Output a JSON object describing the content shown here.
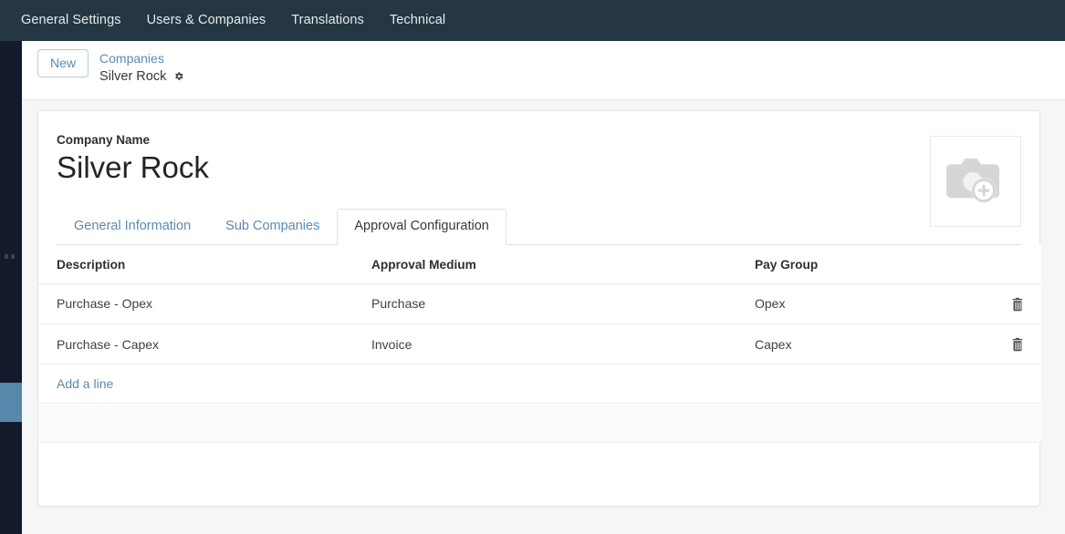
{
  "navbar": {
    "items": [
      {
        "label": "General Settings",
        "name": "nav-general-settings"
      },
      {
        "label": "Users & Companies",
        "name": "nav-users-companies"
      },
      {
        "label": "Translations",
        "name": "nav-translations"
      },
      {
        "label": "Technical",
        "name": "nav-technical"
      }
    ],
    "background_color": "#243742",
    "text_color": "#e6eaec"
  },
  "control_panel": {
    "new_button_label": "New",
    "breadcrumb": {
      "parent_label": "Companies",
      "current_label": "Silver Rock",
      "gear_icon": "gear-icon"
    }
  },
  "form": {
    "company_name_label": "Company Name",
    "company_name_value": "Silver Rock",
    "image_placeholder_icon": "camera-plus-icon"
  },
  "tabs": [
    {
      "label": "General Information",
      "name": "tab-general-information",
      "active": false
    },
    {
      "label": "Sub Companies",
      "name": "tab-sub-companies",
      "active": false
    },
    {
      "label": "Approval Configuration",
      "name": "tab-approval-configuration",
      "active": true
    }
  ],
  "table": {
    "columns": [
      {
        "label": "Description",
        "name": "column-description"
      },
      {
        "label": "Approval Medium",
        "name": "column-approval-medium"
      },
      {
        "label": "Pay Group",
        "name": "column-pay-group"
      }
    ],
    "rows": [
      {
        "description": "Purchase - Opex",
        "approval_medium": "Purchase",
        "pay_group": "Opex",
        "delete_icon": "trash-icon"
      },
      {
        "description": "Purchase - Capex",
        "approval_medium": "Invoice",
        "pay_group": "Capex",
        "delete_icon": "trash-icon"
      }
    ],
    "add_line_label": "Add a line"
  },
  "theme": {
    "link_color": "#5b8ab0",
    "navbar_color": "#243742",
    "rail_color": "#141a2c",
    "rail_active_color": "#5688ac",
    "page_background": "#f4f6f7",
    "sheet_background": "#ffffff",
    "border_color": "#e3e7ea"
  }
}
